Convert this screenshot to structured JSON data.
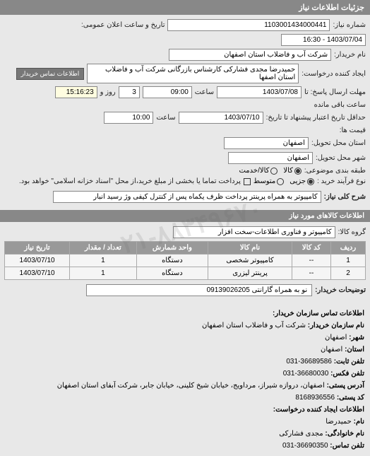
{
  "page_header": "جزئیات اطلاعات نیاز",
  "watermark": "۰۲۱-۸۸۳۴۹۶۷۰",
  "header": {
    "need_no_label": "شماره نیاز:",
    "need_no": "1103001434000441",
    "announce_label": "تاریخ و ساعت اعلان عمومی:",
    "announce_value": "1403/07/04 - 16:30",
    "buyer_name_label": "نام خریدار:",
    "buyer_name": "شرکت آب و فاضلاب استان اصفهان",
    "request_creator_label": "ایجاد کننده درخواست:",
    "request_creator": "حمیدرضا مجدی فشارکی کارشناس بازرگانی شرکت آب و فاضلاب استان اصفها",
    "buyer_contact_btn": "اطلاعات تماس خریدار"
  },
  "dates": {
    "send_deadline_label": "مهلت ارسال پاسخ: تا",
    "send_date": "1403/07/08",
    "send_time_label": "ساعت",
    "send_time": "09:00",
    "send_days": "3",
    "send_days_label": "روز و",
    "remaining_time": "15:16:23",
    "remaining_label": "ساعت باقی مانده",
    "validity_label": "حداقل تاریخ اعتبار پیشنهاد تا تاریخ:",
    "validity_date": "1403/07/10",
    "validity_time_label": "ساعت",
    "validity_time": "10:00",
    "price_label": "قیمت ها:"
  },
  "location": {
    "delivery_province_label": "استان محل تحویل:",
    "delivery_province": "اصفهان",
    "delivery_city_label": "شهر محل تحویل:",
    "delivery_city": "اصفهان"
  },
  "options": {
    "budget_label": "طبقه بندی موضوعی:",
    "opt_kala": "کالا",
    "opt_khadamat": "کالا/خدمت",
    "purchase_type_label": "نوع فرآیند خرید :",
    "opt_low": "جزیی",
    "opt_mid": "متوسط",
    "note": "پرداخت تماما یا بخشی از مبلغ خرید،از محل \"اسناد خزانه اسلامی\" خواهد بود.",
    "checkbox_label": ""
  },
  "need": {
    "desc_label": "شرح کلی نیاز:",
    "desc": "کامپیوتر به همراه پرینتر پرداخت ظرف یکماه پس از کنترل کیفی وژ رسید انبار"
  },
  "goods_section": "اطلاعات کالاهای مورد نیاز",
  "goods_group_label": "گروه کالا:",
  "goods_group": "کامپیوتر و فناوری اطلاعات-سخت افزار",
  "table": {
    "headers": [
      "ردیف",
      "کد کالا",
      "نام کالا",
      "واحد شمارش",
      "تعداد / مقدار",
      "تاریخ نیاز"
    ],
    "rows": [
      [
        "1",
        "--",
        "کامپیوتر شخصی",
        "دستگاه",
        "1",
        "1403/07/10"
      ],
      [
        "2",
        "--",
        "پرینتر لیزری",
        "دستگاه",
        "1",
        "1403/07/10"
      ]
    ]
  },
  "buyer_notes_label": "توضیحات خریدار:",
  "buyer_notes": "نو به همراه گارانتی 09139026205",
  "contact_section_title": "اطلاعات تماس سازمان خریدار:",
  "contact": {
    "org_label": "نام سازمان خریدار:",
    "org": "شرکت آب و فاضلاب استان اصفهان",
    "city_label": "شهر:",
    "city": "اصفهان",
    "province_label": "استان:",
    "province": "اصفهان",
    "phone_label": "تلفن ثابت:",
    "phone": "36689586-031",
    "fax_label": "تلفن فکس:",
    "fax": "36680030-031",
    "address_label": "آدرس پستی:",
    "address": "اصفهان، دروازه شیراز، مرداویج، خیابان شیخ کلینی، خیابان جابر، شرکت آبفای استان اصفهان",
    "postal_label": "کد پستی:",
    "postal": "8168936556",
    "creator_section": "اطلاعات ایجاد کننده درخواست:",
    "fname_label": "نام:",
    "fname": "حمیدرضا",
    "lname_label": "نام خانوادگی:",
    "lname": "مجدی فشارکی",
    "cphone_label": "تلفن تماس:",
    "cphone": "36690350-031"
  }
}
